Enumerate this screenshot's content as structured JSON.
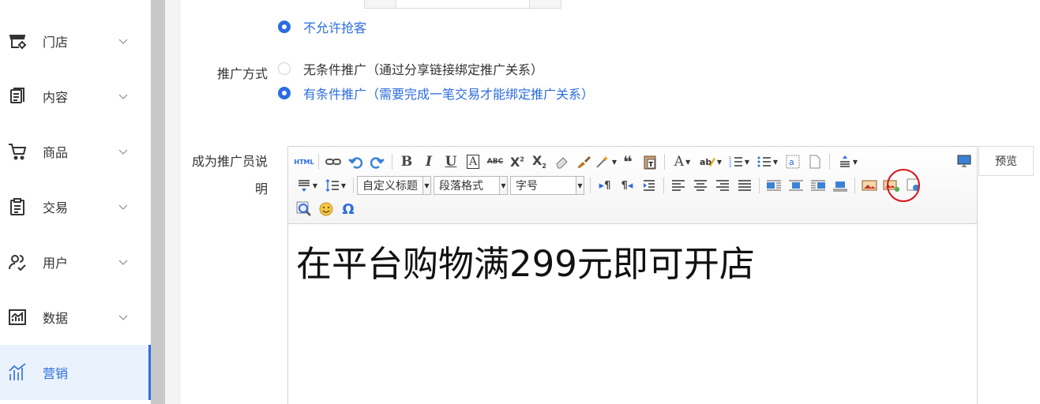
{
  "sidebar": {
    "items": [
      {
        "label": "门店",
        "icon": "store-icon"
      },
      {
        "label": "内容",
        "icon": "content-icon"
      },
      {
        "label": "商品",
        "icon": "cart-icon"
      },
      {
        "label": "交易",
        "icon": "clipboard-icon"
      },
      {
        "label": "用户",
        "icon": "users-icon"
      },
      {
        "label": "数据",
        "icon": "chart-icon"
      },
      {
        "label": "营销",
        "icon": "marketing-icon",
        "active": true
      }
    ]
  },
  "form": {
    "no_guest_option": "不允许抢客",
    "promo_method": {
      "label": "推广方式",
      "options": [
        {
          "text": "无条件推广（通过分享链接绑定推广关系）",
          "checked": false
        },
        {
          "text": "有条件推广（需要完成一笔交易才能绑定推广关系）",
          "checked": true
        }
      ]
    },
    "promoter_desc": {
      "label_line1": "成为推广员说",
      "label_line2": "明"
    }
  },
  "editor": {
    "content": "在平台购物满299元即可开店",
    "selects": {
      "title": "自定义标题",
      "paragraph": "段落格式",
      "fontsize": "字号"
    },
    "html_label": "HTML"
  },
  "preview_label": "预览",
  "colors": {
    "accent": "#2d6cdf",
    "highlight_circle": "#d6141c"
  }
}
